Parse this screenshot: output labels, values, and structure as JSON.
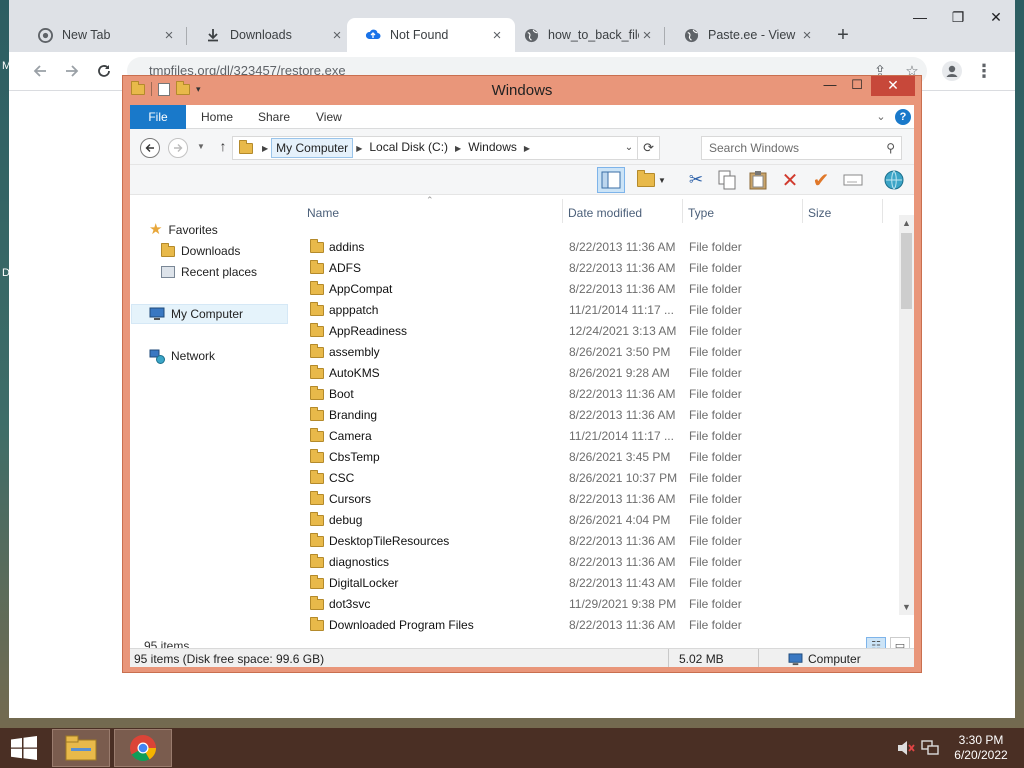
{
  "browser": {
    "tabs": [
      {
        "title": "New Tab",
        "icon": "chrome-icon"
      },
      {
        "title": "Downloads",
        "icon": "download-icon"
      },
      {
        "title": "Not Found",
        "icon": "cloud-icon",
        "active": true
      },
      {
        "title": "how_to_back_files",
        "icon": "globe-icon"
      },
      {
        "title": "Paste.ee - View p",
        "icon": "globe-icon"
      }
    ],
    "url": "tmpfiles.org/dl/323457/restore.exe"
  },
  "desktop": {
    "edge_letters": [
      "M",
      "D"
    ]
  },
  "explorer": {
    "title": "Windows",
    "ribbon_tabs": [
      "File",
      "Home",
      "Share",
      "View"
    ],
    "breadcrumb": [
      "My Computer",
      "Local Disk (C:)",
      "Windows"
    ],
    "search_placeholder": "Search Windows",
    "nav": {
      "favorites": "Favorites",
      "downloads": "Downloads",
      "recent": "Recent places",
      "computer": "My Computer",
      "network": "Network"
    },
    "columns": [
      "Name",
      "Date modified",
      "Type",
      "Size"
    ],
    "files": [
      {
        "name": "addins",
        "date": "8/22/2013 11:36 AM",
        "type": "File folder"
      },
      {
        "name": "ADFS",
        "date": "8/22/2013 11:36 AM",
        "type": "File folder"
      },
      {
        "name": "AppCompat",
        "date": "8/22/2013 11:36 AM",
        "type": "File folder"
      },
      {
        "name": "apppatch",
        "date": "11/21/2014 11:17 ...",
        "type": "File folder"
      },
      {
        "name": "AppReadiness",
        "date": "12/24/2021 3:13 AM",
        "type": "File folder"
      },
      {
        "name": "assembly",
        "date": "8/26/2021 3:50 PM",
        "type": "File folder"
      },
      {
        "name": "AutoKMS",
        "date": "8/26/2021 9:28 AM",
        "type": "File folder"
      },
      {
        "name": "Boot",
        "date": "8/22/2013 11:36 AM",
        "type": "File folder"
      },
      {
        "name": "Branding",
        "date": "8/22/2013 11:36 AM",
        "type": "File folder"
      },
      {
        "name": "Camera",
        "date": "11/21/2014 11:17 ...",
        "type": "File folder"
      },
      {
        "name": "CbsTemp",
        "date": "8/26/2021 3:45 PM",
        "type": "File folder"
      },
      {
        "name": "CSC",
        "date": "8/26/2021 10:37 PM",
        "type": "File folder"
      },
      {
        "name": "Cursors",
        "date": "8/22/2013 11:36 AM",
        "type": "File folder"
      },
      {
        "name": "debug",
        "date": "8/26/2021 4:04 PM",
        "type": "File folder"
      },
      {
        "name": "DesktopTileResources",
        "date": "8/22/2013 11:36 AM",
        "type": "File folder"
      },
      {
        "name": "diagnostics",
        "date": "8/22/2013 11:36 AM",
        "type": "File folder"
      },
      {
        "name": "DigitalLocker",
        "date": "8/22/2013 11:43 AM",
        "type": "File folder"
      },
      {
        "name": "dot3svc",
        "date": "11/29/2021 9:38 PM",
        "type": "File folder"
      },
      {
        "name": "Downloaded Program Files",
        "date": "8/22/2013 11:36 AM",
        "type": "File folder"
      }
    ],
    "item_count": "95 items",
    "status": {
      "summary": "95 items (Disk free space: 99.6 GB)",
      "size": "5.02 MB",
      "location": "Computer"
    }
  },
  "taskbar": {
    "time": "3:30 PM",
    "date": "6/20/2022"
  }
}
